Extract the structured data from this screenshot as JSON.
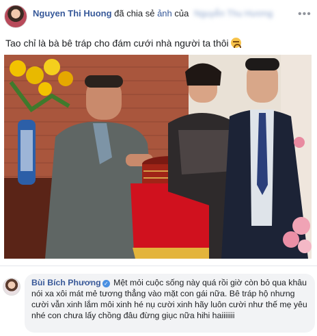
{
  "post": {
    "author": "Nguyen Thi Huong",
    "shared_text": "đã chia sẻ",
    "object": "ảnh",
    "of_text": "của",
    "blurred_name": "Nguyễn Thu Hương",
    "more_icon": "more-horizontal-icon",
    "status_text": "Tao chỉ là bà bê tráp cho đám cưới nhà người ta thôi",
    "status_emoji": "crying-face-icon"
  },
  "comment": {
    "author": "Bùi Bích Phương",
    "verified_icon": "verified-badge-icon",
    "text": "Mệt mỏi cuộc sống này quá rồi giờ còn bỏ qua khâu nói xa xôi mát mẻ tương thẳng vào mặt con gái nữa. Bê tráp hộ nhưng cười vẫn xinh lắm môi xinh hé nụ cười xinh hãy luôn cười như thế mẹ yêu nhé con chưa lấy chồng đâu đừng giục nữa hihi haiiiiiii"
  },
  "colors": {
    "link": "#365899",
    "bubble": "#f2f3f5",
    "tray_red": "#d0111e",
    "fringe_gold": "#e3b43b"
  }
}
